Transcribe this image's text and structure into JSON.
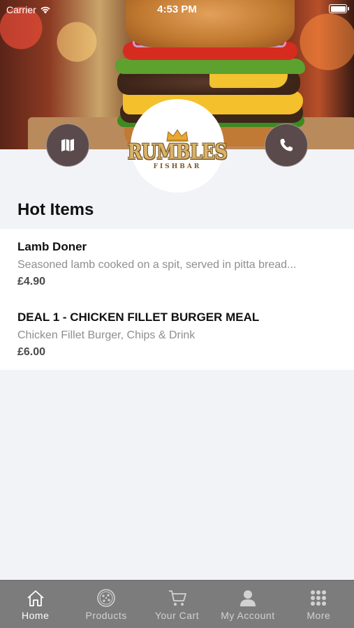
{
  "status_bar": {
    "carrier": "Carrier",
    "time": "4:53 PM"
  },
  "header": {
    "logo_text": "RUMBLES",
    "logo_subtext": "FISHBAR",
    "map_button_icon": "map-icon",
    "call_button_icon": "phone-icon"
  },
  "hot_items": {
    "title": "Hot Items",
    "items": [
      {
        "name": "Lamb Doner",
        "description": "Seasoned lamb cooked on a spit, served in pitta bread...",
        "price": "£4.90"
      },
      {
        "name": "DEAL 1 - CHICKEN FILLET BURGER MEAL",
        "description": "Chicken Fillet Burger, Chips & Drink",
        "price": "£6.00"
      }
    ]
  },
  "tab_bar": {
    "tabs": [
      {
        "label": "Home",
        "icon": "home-icon",
        "active": true
      },
      {
        "label": "Products",
        "icon": "pizza-icon",
        "active": false
      },
      {
        "label": "Your Cart",
        "icon": "cart-icon",
        "active": false
      },
      {
        "label": "My Account",
        "icon": "user-icon",
        "active": false
      },
      {
        "label": "More",
        "icon": "grid-icon",
        "active": false
      }
    ]
  },
  "colors": {
    "tab_bar_bg": "#7c7c7c",
    "action_button_bg": "#5b4a4b",
    "page_bg": "#f2f3f7",
    "logo_gold": "#d9b36a"
  }
}
